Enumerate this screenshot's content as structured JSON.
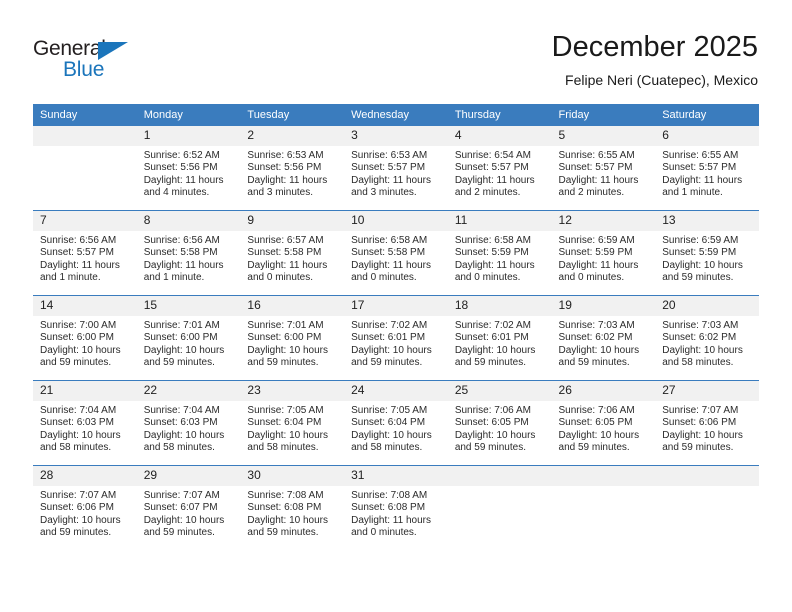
{
  "branding": {
    "logo_text_primary": "General",
    "logo_text_secondary": "Blue",
    "logo_icon": "triangle-icon",
    "accent_color": "#1b75bb"
  },
  "header": {
    "title": "December 2025",
    "subtitle": "Felipe Neri (Cuatepec), Mexico"
  },
  "calendar": {
    "header_bg_color": "#3a7cbe",
    "daynum_bg_color": "#f1f1f1",
    "weekday_headers": [
      "Sunday",
      "Monday",
      "Tuesday",
      "Wednesday",
      "Thursday",
      "Friday",
      "Saturday"
    ],
    "weeks": [
      [
        {
          "day": "",
          "sunrise": "",
          "sunset": "",
          "daylight_1": "",
          "daylight_2": ""
        },
        {
          "day": "1",
          "sunrise": "Sunrise: 6:52 AM",
          "sunset": "Sunset: 5:56 PM",
          "daylight_1": "Daylight: 11 hours",
          "daylight_2": "and 4 minutes."
        },
        {
          "day": "2",
          "sunrise": "Sunrise: 6:53 AM",
          "sunset": "Sunset: 5:56 PM",
          "daylight_1": "Daylight: 11 hours",
          "daylight_2": "and 3 minutes."
        },
        {
          "day": "3",
          "sunrise": "Sunrise: 6:53 AM",
          "sunset": "Sunset: 5:57 PM",
          "daylight_1": "Daylight: 11 hours",
          "daylight_2": "and 3 minutes."
        },
        {
          "day": "4",
          "sunrise": "Sunrise: 6:54 AM",
          "sunset": "Sunset: 5:57 PM",
          "daylight_1": "Daylight: 11 hours",
          "daylight_2": "and 2 minutes."
        },
        {
          "day": "5",
          "sunrise": "Sunrise: 6:55 AM",
          "sunset": "Sunset: 5:57 PM",
          "daylight_1": "Daylight: 11 hours",
          "daylight_2": "and 2 minutes."
        },
        {
          "day": "6",
          "sunrise": "Sunrise: 6:55 AM",
          "sunset": "Sunset: 5:57 PM",
          "daylight_1": "Daylight: 11 hours",
          "daylight_2": "and 1 minute."
        }
      ],
      [
        {
          "day": "7",
          "sunrise": "Sunrise: 6:56 AM",
          "sunset": "Sunset: 5:57 PM",
          "daylight_1": "Daylight: 11 hours",
          "daylight_2": "and 1 minute."
        },
        {
          "day": "8",
          "sunrise": "Sunrise: 6:56 AM",
          "sunset": "Sunset: 5:58 PM",
          "daylight_1": "Daylight: 11 hours",
          "daylight_2": "and 1 minute."
        },
        {
          "day": "9",
          "sunrise": "Sunrise: 6:57 AM",
          "sunset": "Sunset: 5:58 PM",
          "daylight_1": "Daylight: 11 hours",
          "daylight_2": "and 0 minutes."
        },
        {
          "day": "10",
          "sunrise": "Sunrise: 6:58 AM",
          "sunset": "Sunset: 5:58 PM",
          "daylight_1": "Daylight: 11 hours",
          "daylight_2": "and 0 minutes."
        },
        {
          "day": "11",
          "sunrise": "Sunrise: 6:58 AM",
          "sunset": "Sunset: 5:59 PM",
          "daylight_1": "Daylight: 11 hours",
          "daylight_2": "and 0 minutes."
        },
        {
          "day": "12",
          "sunrise": "Sunrise: 6:59 AM",
          "sunset": "Sunset: 5:59 PM",
          "daylight_1": "Daylight: 11 hours",
          "daylight_2": "and 0 minutes."
        },
        {
          "day": "13",
          "sunrise": "Sunrise: 6:59 AM",
          "sunset": "Sunset: 5:59 PM",
          "daylight_1": "Daylight: 10 hours",
          "daylight_2": "and 59 minutes."
        }
      ],
      [
        {
          "day": "14",
          "sunrise": "Sunrise: 7:00 AM",
          "sunset": "Sunset: 6:00 PM",
          "daylight_1": "Daylight: 10 hours",
          "daylight_2": "and 59 minutes."
        },
        {
          "day": "15",
          "sunrise": "Sunrise: 7:01 AM",
          "sunset": "Sunset: 6:00 PM",
          "daylight_1": "Daylight: 10 hours",
          "daylight_2": "and 59 minutes."
        },
        {
          "day": "16",
          "sunrise": "Sunrise: 7:01 AM",
          "sunset": "Sunset: 6:00 PM",
          "daylight_1": "Daylight: 10 hours",
          "daylight_2": "and 59 minutes."
        },
        {
          "day": "17",
          "sunrise": "Sunrise: 7:02 AM",
          "sunset": "Sunset: 6:01 PM",
          "daylight_1": "Daylight: 10 hours",
          "daylight_2": "and 59 minutes."
        },
        {
          "day": "18",
          "sunrise": "Sunrise: 7:02 AM",
          "sunset": "Sunset: 6:01 PM",
          "daylight_1": "Daylight: 10 hours",
          "daylight_2": "and 59 minutes."
        },
        {
          "day": "19",
          "sunrise": "Sunrise: 7:03 AM",
          "sunset": "Sunset: 6:02 PM",
          "daylight_1": "Daylight: 10 hours",
          "daylight_2": "and 59 minutes."
        },
        {
          "day": "20",
          "sunrise": "Sunrise: 7:03 AM",
          "sunset": "Sunset: 6:02 PM",
          "daylight_1": "Daylight: 10 hours",
          "daylight_2": "and 58 minutes."
        }
      ],
      [
        {
          "day": "21",
          "sunrise": "Sunrise: 7:04 AM",
          "sunset": "Sunset: 6:03 PM",
          "daylight_1": "Daylight: 10 hours",
          "daylight_2": "and 58 minutes."
        },
        {
          "day": "22",
          "sunrise": "Sunrise: 7:04 AM",
          "sunset": "Sunset: 6:03 PM",
          "daylight_1": "Daylight: 10 hours",
          "daylight_2": "and 58 minutes."
        },
        {
          "day": "23",
          "sunrise": "Sunrise: 7:05 AM",
          "sunset": "Sunset: 6:04 PM",
          "daylight_1": "Daylight: 10 hours",
          "daylight_2": "and 58 minutes."
        },
        {
          "day": "24",
          "sunrise": "Sunrise: 7:05 AM",
          "sunset": "Sunset: 6:04 PM",
          "daylight_1": "Daylight: 10 hours",
          "daylight_2": "and 58 minutes."
        },
        {
          "day": "25",
          "sunrise": "Sunrise: 7:06 AM",
          "sunset": "Sunset: 6:05 PM",
          "daylight_1": "Daylight: 10 hours",
          "daylight_2": "and 59 minutes."
        },
        {
          "day": "26",
          "sunrise": "Sunrise: 7:06 AM",
          "sunset": "Sunset: 6:05 PM",
          "daylight_1": "Daylight: 10 hours",
          "daylight_2": "and 59 minutes."
        },
        {
          "day": "27",
          "sunrise": "Sunrise: 7:07 AM",
          "sunset": "Sunset: 6:06 PM",
          "daylight_1": "Daylight: 10 hours",
          "daylight_2": "and 59 minutes."
        }
      ],
      [
        {
          "day": "28",
          "sunrise": "Sunrise: 7:07 AM",
          "sunset": "Sunset: 6:06 PM",
          "daylight_1": "Daylight: 10 hours",
          "daylight_2": "and 59 minutes."
        },
        {
          "day": "29",
          "sunrise": "Sunrise: 7:07 AM",
          "sunset": "Sunset: 6:07 PM",
          "daylight_1": "Daylight: 10 hours",
          "daylight_2": "and 59 minutes."
        },
        {
          "day": "30",
          "sunrise": "Sunrise: 7:08 AM",
          "sunset": "Sunset: 6:08 PM",
          "daylight_1": "Daylight: 10 hours",
          "daylight_2": "and 59 minutes."
        },
        {
          "day": "31",
          "sunrise": "Sunrise: 7:08 AM",
          "sunset": "Sunset: 6:08 PM",
          "daylight_1": "Daylight: 11 hours",
          "daylight_2": "and 0 minutes."
        },
        {
          "day": "",
          "sunrise": "",
          "sunset": "",
          "daylight_1": "",
          "daylight_2": ""
        },
        {
          "day": "",
          "sunrise": "",
          "sunset": "",
          "daylight_1": "",
          "daylight_2": ""
        },
        {
          "day": "",
          "sunrise": "",
          "sunset": "",
          "daylight_1": "",
          "daylight_2": ""
        }
      ]
    ]
  }
}
